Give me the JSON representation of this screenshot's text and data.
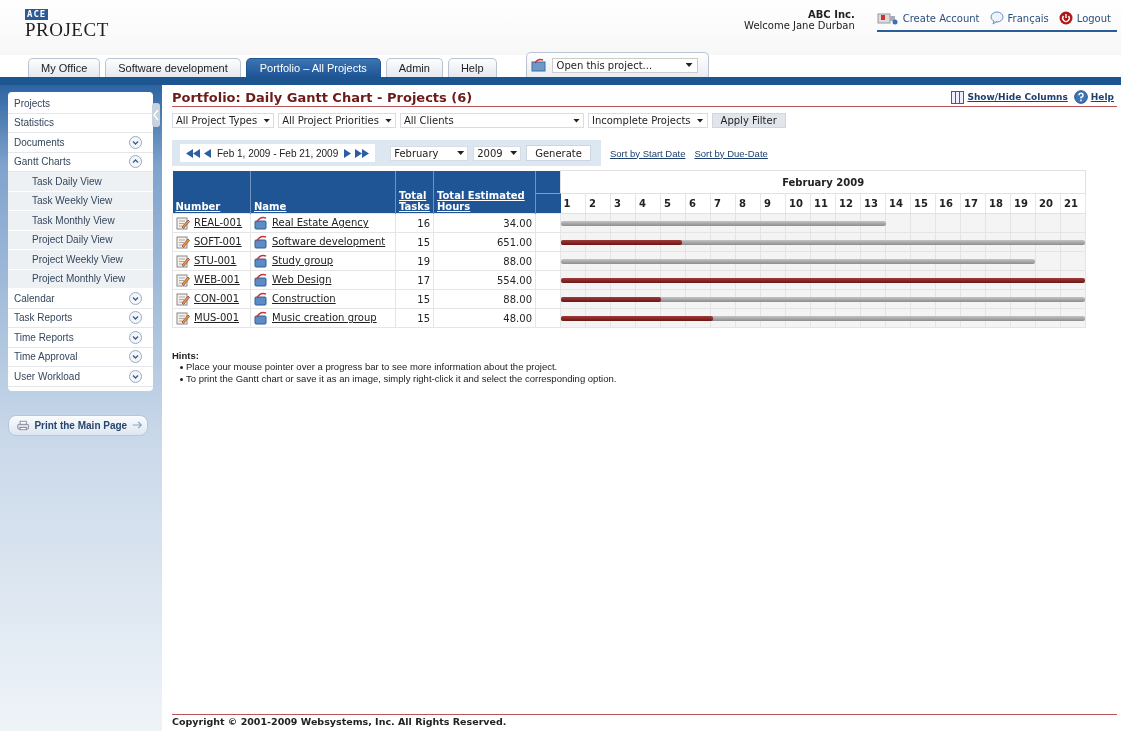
{
  "header": {
    "logo": {
      "badge": "ACE",
      "name": "PROJECT"
    },
    "company": "ABC Inc.",
    "welcome": "Welcome Jane Durban",
    "links": [
      {
        "label": "Create Account",
        "kind": "account"
      },
      {
        "label": "Français",
        "kind": "language"
      },
      {
        "label": "Logout",
        "kind": "logout"
      }
    ]
  },
  "tabs": [
    {
      "label": "My Office",
      "selected": false
    },
    {
      "label": "Software development",
      "selected": false
    },
    {
      "label": "Portfolio – All Projects",
      "selected": true
    },
    {
      "label": "Admin",
      "selected": false
    },
    {
      "label": "Help",
      "selected": false
    }
  ],
  "project_picker": {
    "value": "Open this project..."
  },
  "sidebar": {
    "items": [
      {
        "label": "Projects",
        "kind": "link"
      },
      {
        "label": "Statistics",
        "kind": "link"
      },
      {
        "label": "Documents",
        "kind": "group",
        "expanded": false
      },
      {
        "label": "Gantt Charts",
        "kind": "group",
        "expanded": true,
        "children": [
          {
            "label": "Task Daily View"
          },
          {
            "label": "Task Weekly View"
          },
          {
            "label": "Task Monthly View"
          },
          {
            "label": "Project Daily View"
          },
          {
            "label": "Project Weekly View"
          },
          {
            "label": "Project Monthly View"
          }
        ]
      },
      {
        "label": "Calendar",
        "kind": "group",
        "expanded": false
      },
      {
        "label": "Task Reports",
        "kind": "group",
        "expanded": false
      },
      {
        "label": "Time Reports",
        "kind": "group",
        "expanded": false
      },
      {
        "label": "Time Approval",
        "kind": "group",
        "expanded": false
      },
      {
        "label": "User Workload",
        "kind": "group",
        "expanded": false
      }
    ],
    "print_button": "Print the Main Page"
  },
  "page_title": "Portfolio: Daily Gantt Chart - Projects (6)",
  "title_links": [
    {
      "label": "Show/Hide Columns",
      "kind": "columns"
    },
    {
      "label": "Help",
      "kind": "help"
    }
  ],
  "filters": {
    "selects": [
      "All Project Types",
      "All Project Priorities",
      "All Clients",
      "Incomplete Projects"
    ],
    "apply_button": "Apply Filter"
  },
  "date_range": {
    "label": "Feb 1, 2009 - Feb 21, 2009",
    "month": "February",
    "year": "2009",
    "generate_button": "Generate",
    "sort_links": [
      "Sort by Start Date",
      "Sort by Due-Date"
    ]
  },
  "table": {
    "columns": [
      "Number",
      "Name",
      "Total Tasks",
      "Total Estimated Hours"
    ],
    "month": "February 2009",
    "days": [
      "1",
      "2",
      "3",
      "4",
      "5",
      "6",
      "7",
      "8",
      "9",
      "10",
      "11",
      "12",
      "13",
      "14",
      "15",
      "16",
      "17",
      "18",
      "19",
      "20",
      "21"
    ],
    "rows": [
      {
        "number": "REAL-001",
        "name": "Real Estate Agency",
        "tasks": "16",
        "hours": "34.00",
        "schedule": {
          "level": 0.62
        },
        "progress": {
          "level": 0
        }
      },
      {
        "number": "SOFT-001",
        "name": "Software development",
        "tasks": "15",
        "hours": "651.00",
        "schedule": {
          "level": 1
        },
        "progress": {
          "level": 0.23
        }
      },
      {
        "number": "STU-001",
        "name": "Study group",
        "tasks": "19",
        "hours": "88.00",
        "schedule": {
          "level": 0.905
        },
        "progress": {
          "level": 0
        }
      },
      {
        "number": "WEB-001",
        "name": "Web Design",
        "tasks": "17",
        "hours": "554.00",
        "schedule": {
          "level": 1
        },
        "progress": {
          "level": 1
        }
      },
      {
        "number": "CON-001",
        "name": "Construction",
        "tasks": "15",
        "hours": "88.00",
        "schedule": {
          "level": 1
        },
        "progress": {
          "level": 0.19
        }
      },
      {
        "number": "MUS-001",
        "name": "Music creation group",
        "tasks": "15",
        "hours": "48.00",
        "schedule": {
          "level": 1
        },
        "progress": {
          "level": 0.29
        }
      }
    ]
  },
  "hints": {
    "title": "Hints:",
    "items": [
      "Place your mouse pointer over a progress bar to see more information about the project.",
      "To print the Gantt chart or save it as an image, simply right-click it and select the corresponding option."
    ]
  },
  "footer": "Copyright © 2001-2009 Websystems, Inc. All Rights Reserved."
}
